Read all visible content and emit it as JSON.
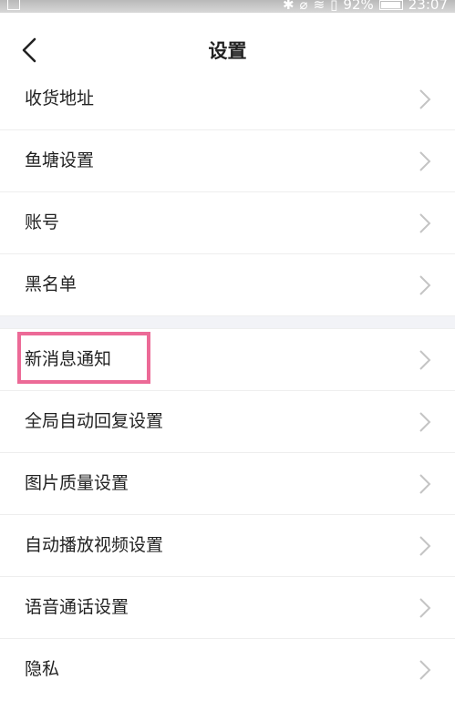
{
  "status_bar": {
    "battery": "92%",
    "time": "23:07"
  },
  "header": {
    "title": "设置"
  },
  "groups": [
    {
      "items": [
        {
          "label": "收货地址"
        },
        {
          "label": "鱼塘设置"
        },
        {
          "label": "账号"
        },
        {
          "label": "黑名单"
        }
      ]
    },
    {
      "items": [
        {
          "label": "新消息通知"
        },
        {
          "label": "全局自动回复设置"
        },
        {
          "label": "图片质量设置"
        },
        {
          "label": "自动播放视频设置"
        },
        {
          "label": "语音通话设置"
        },
        {
          "label": "隐私"
        }
      ]
    }
  ],
  "highlight_color": "#ec6a97"
}
